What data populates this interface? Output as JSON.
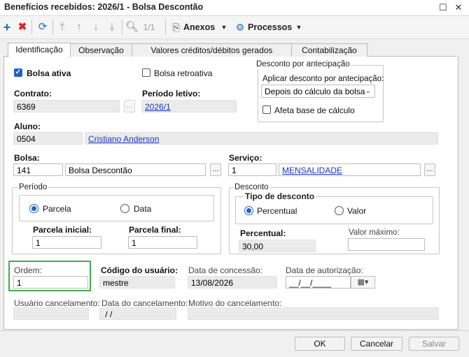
{
  "window": {
    "title": "Benefícios recebidos: 2026/1 - Bolsa Descontão"
  },
  "toolbar": {
    "record_count": "1/1",
    "anexos": "Anexos",
    "processos": "Processos"
  },
  "tabs": [
    {
      "label": "Identificação"
    },
    {
      "label": "Observação"
    },
    {
      "label": "Valores créditos/débitos gerados"
    },
    {
      "label": "Contabilização"
    }
  ],
  "form": {
    "bolsa_ativa": "Bolsa ativa",
    "bolsa_retroativa": "Bolsa retroativa",
    "desconto_antecipacao": {
      "title": "Desconto por antecipação",
      "aplicar_label": "Aplicar desconto por antecipação:",
      "aplicar_value": "Depois do cálculo da bolsa",
      "afeta_base": "Afeta base de cálculo"
    },
    "contrato_label": "Contrato:",
    "contrato_value": "6369",
    "periodo_letivo_label": "Período letivo:",
    "periodo_letivo_value": "2026/1",
    "aluno_label": "Aluno:",
    "aluno_code": "0504",
    "aluno_name": "Cristiano Anderson",
    "bolsa_label": "Bolsa:",
    "bolsa_code": "141",
    "bolsa_name": "Bolsa Descontão",
    "servico_label": "Serviço:",
    "servico_code": "1",
    "servico_name": "MENSALIDADE",
    "periodo": {
      "title": "Período",
      "parcela": "Parcela",
      "data": "Data",
      "parcela_inicial_label": "Parcela inicial:",
      "parcela_inicial_value": "1",
      "parcela_final_label": "Parcela final:",
      "parcela_final_value": "1"
    },
    "desconto": {
      "title": "Desconto",
      "tipo_title": "Tipo de desconto",
      "percentual_opt": "Percentual",
      "valor_opt": "Valor",
      "percentual_label": "Percentual:",
      "percentual_value": "30,00",
      "valor_maximo_label": "Valor máximo:",
      "valor_maximo_value": ""
    },
    "ordem_label": "Ordem:",
    "ordem_value": "1",
    "codigo_usuario_label": "Código do usuário:",
    "codigo_usuario_value": "mestre",
    "data_concessao_label": "Data de concessão:",
    "data_concessao_value": "13/08/2026",
    "data_autorizacao_label": "Data de autorização:",
    "data_autorizacao_value": "__/__/____",
    "usuario_cancelamento_label": "Usuário cancelamento:",
    "data_cancelamento_label": "Data do cancelamento:",
    "data_cancelamento_value": " / /",
    "motivo_cancelamento_label": "Motivo do cancelamento:"
  },
  "footer": {
    "ok": "OK",
    "cancelar": "Cancelar",
    "salvar": "Salvar"
  },
  "colors": {
    "accent": "#1f63c8",
    "toolbar_blue": "#1a6fc9",
    "delete_red": "#d9262c",
    "highlight_green": "#3fae49"
  }
}
